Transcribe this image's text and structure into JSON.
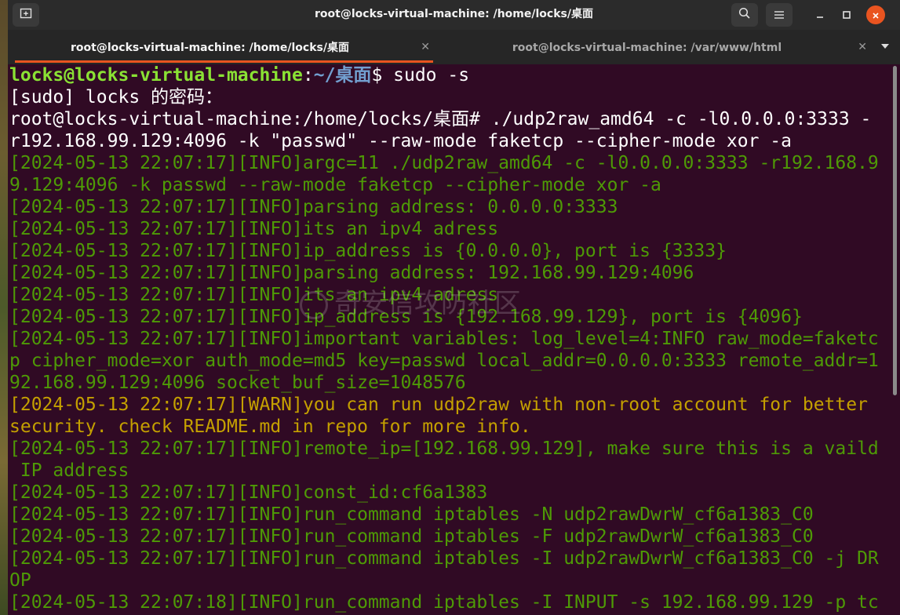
{
  "window": {
    "title": "root@locks-virtual-machine: /home/locks/桌面"
  },
  "tabs": [
    {
      "label": "root@locks-virtual-machine: /home/locks/桌面",
      "active": true
    },
    {
      "label": "root@locks-virtual-machine: /var/www/html",
      "active": false
    }
  ],
  "icons": {
    "new_tab": "plus-square-icon",
    "search": "search-icon",
    "menu": "hamburger-menu-icon",
    "minimize": "minimize-icon",
    "maximize": "maximize-icon",
    "close": "close-icon",
    "tab_close": "close-icon",
    "tab_menu": "chevron-down-icon"
  },
  "colors": {
    "terminal_bg": "#300a24",
    "info_text": "#4e9a06",
    "warn_text": "#c4a000",
    "prompt_user": "#8ae234",
    "prompt_path": "#729fcf",
    "accent": "#e95420"
  },
  "terminal": {
    "prompt": {
      "user_host": "locks@locks-virtual-machine",
      "sep": ":",
      "path": "~/桌面",
      "symbol": "$ ",
      "command": "sudo -s"
    },
    "lines": [
      {
        "style": "white",
        "text": "[sudo] locks 的密码："
      },
      {
        "style": "white",
        "text": "root@locks-virtual-machine:/home/locks/桌面# ./udp2raw_amd64 -c -l0.0.0.0:3333 -"
      },
      {
        "style": "white",
        "text": "r192.168.99.129:4096 -k \"passwd\" --raw-mode faketcp --cipher-mode xor -a"
      },
      {
        "style": "green",
        "text": "[2024-05-13 22:07:17][INFO]argc=11 ./udp2raw_amd64 -c -l0.0.0.0:3333 -r192.168.9"
      },
      {
        "style": "green",
        "text": "9.129:4096 -k passwd --raw-mode faketcp --cipher-mode xor -a"
      },
      {
        "style": "green",
        "text": "[2024-05-13 22:07:17][INFO]parsing address: 0.0.0.0:3333"
      },
      {
        "style": "green",
        "text": "[2024-05-13 22:07:17][INFO]its an ipv4 adress"
      },
      {
        "style": "green",
        "text": "[2024-05-13 22:07:17][INFO]ip_address is {0.0.0.0}, port is {3333}"
      },
      {
        "style": "green",
        "text": "[2024-05-13 22:07:17][INFO]parsing address: 192.168.99.129:4096"
      },
      {
        "style": "green",
        "text": "[2024-05-13 22:07:17][INFO]its an ipv4 adress"
      },
      {
        "style": "green",
        "text": "[2024-05-13 22:07:17][INFO]ip_address is {192.168.99.129}, port is {4096}"
      },
      {
        "style": "green",
        "text": "[2024-05-13 22:07:17][INFO]important variables: log_level=4:INFO raw_mode=faketc"
      },
      {
        "style": "green",
        "text": "p cipher_mode=xor auth_mode=md5 key=passwd local_addr=0.0.0.0:3333 remote_addr=1"
      },
      {
        "style": "green",
        "text": "92.168.99.129:4096 socket_buf_size=1048576"
      },
      {
        "style": "yellow",
        "text": "[2024-05-13 22:07:17][WARN]you can run udp2raw with non-root account for better"
      },
      {
        "style": "yellow",
        "text": "security. check README.md in repo for more info."
      },
      {
        "style": "green",
        "text": "[2024-05-13 22:07:17][INFO]remote_ip=[192.168.99.129], make sure this is a vaild"
      },
      {
        "style": "green",
        "text": " IP address"
      },
      {
        "style": "green",
        "text": "[2024-05-13 22:07:17][INFO]const_id:cf6a1383"
      },
      {
        "style": "green",
        "text": "[2024-05-13 22:07:17][INFO]run_command iptables -N udp2rawDwrW_cf6a1383_C0"
      },
      {
        "style": "green",
        "text": "[2024-05-13 22:07:17][INFO]run_command iptables -F udp2rawDwrW_cf6a1383_C0"
      },
      {
        "style": "green",
        "text": "[2024-05-13 22:07:17][INFO]run_command iptables -I udp2rawDwrW_cf6a1383_C0 -j DR"
      },
      {
        "style": "green",
        "text": "OP"
      },
      {
        "style": "green",
        "text": "[2024-05-13 22:07:18][INFO]run_command iptables -I INPUT -s 192.168.99.129 -p tc"
      }
    ]
  },
  "watermark": "奇安信攻防社区"
}
